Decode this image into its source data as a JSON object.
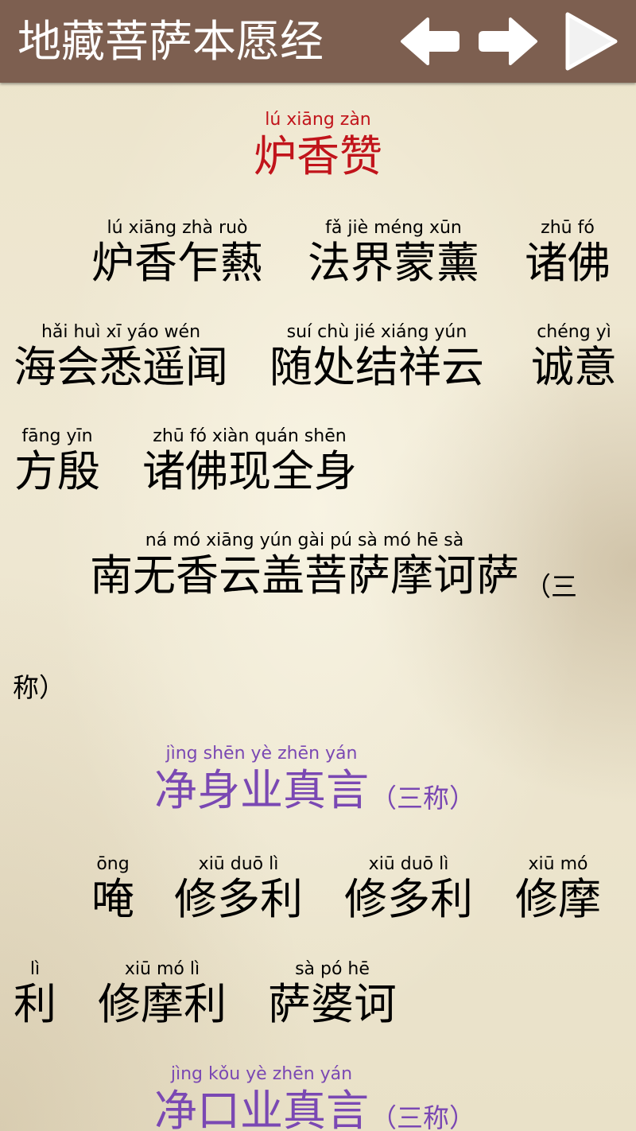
{
  "header": {
    "title": "地藏菩萨本愿经",
    "prev_icon": "arrow-left-icon",
    "next_icon": "arrow-right-icon",
    "play_icon": "play-icon",
    "icon_color": "#ffffff"
  },
  "colors": {
    "header_bg": "#7d5f50",
    "title_red": "#c1141b",
    "mantra_purple": "#7a48b3",
    "text_black": "#000000"
  },
  "sections": [
    {
      "title": {
        "hanzi": "炉香赞",
        "pinyin": "lú  xiāng zàn"
      },
      "text_lines": [
        [
          "炉香乍爇",
          "法界蒙薰",
          "诸佛"
        ],
        [
          "海会悉遥闻",
          "随处结祥云",
          "诚意"
        ],
        [
          "方殷",
          "诸佛现全身"
        ]
      ],
      "pinyin_lines": [
        [
          "lú  xiāng zhà  ruò",
          "fǎ  jiè méng xūn",
          "zhū  fó"
        ],
        [
          "hǎi huì  xī  yáo wén",
          "suí chù  jié xiáng yún",
          "chéng  yì"
        ],
        [
          "fāng yīn",
          "zhū  fó  xiàn quán shēn"
        ]
      ],
      "invocation": {
        "hanzi": "南无香云盖菩萨摩诃萨",
        "pinyin": "ná  mó xiāng yún gài  pú  sà  mó  hē  sà",
        "note_open": "（三",
        "note_close": "称）"
      }
    },
    {
      "title": {
        "hanzi": "净身业真言",
        "pinyin": "jìng shēn  yè  zhēn yán",
        "note": "（三称）"
      },
      "text_lines": [
        [
          "唵",
          "修多利",
          "修多利",
          "修摩"
        ],
        [
          "利",
          "修摩利",
          "萨婆诃"
        ]
      ],
      "pinyin_lines": [
        [
          "ōng",
          "xiū  duō  lì",
          "xiū  duō  lì",
          "xiū  mó"
        ],
        [
          "lì",
          "xiū  mó  lì",
          "sà  pó  hē"
        ]
      ]
    },
    {
      "title": {
        "hanzi": "净口业真言",
        "pinyin": "jìng kǒu  yè  zhēn yán",
        "note": "（三称）"
      }
    }
  ]
}
